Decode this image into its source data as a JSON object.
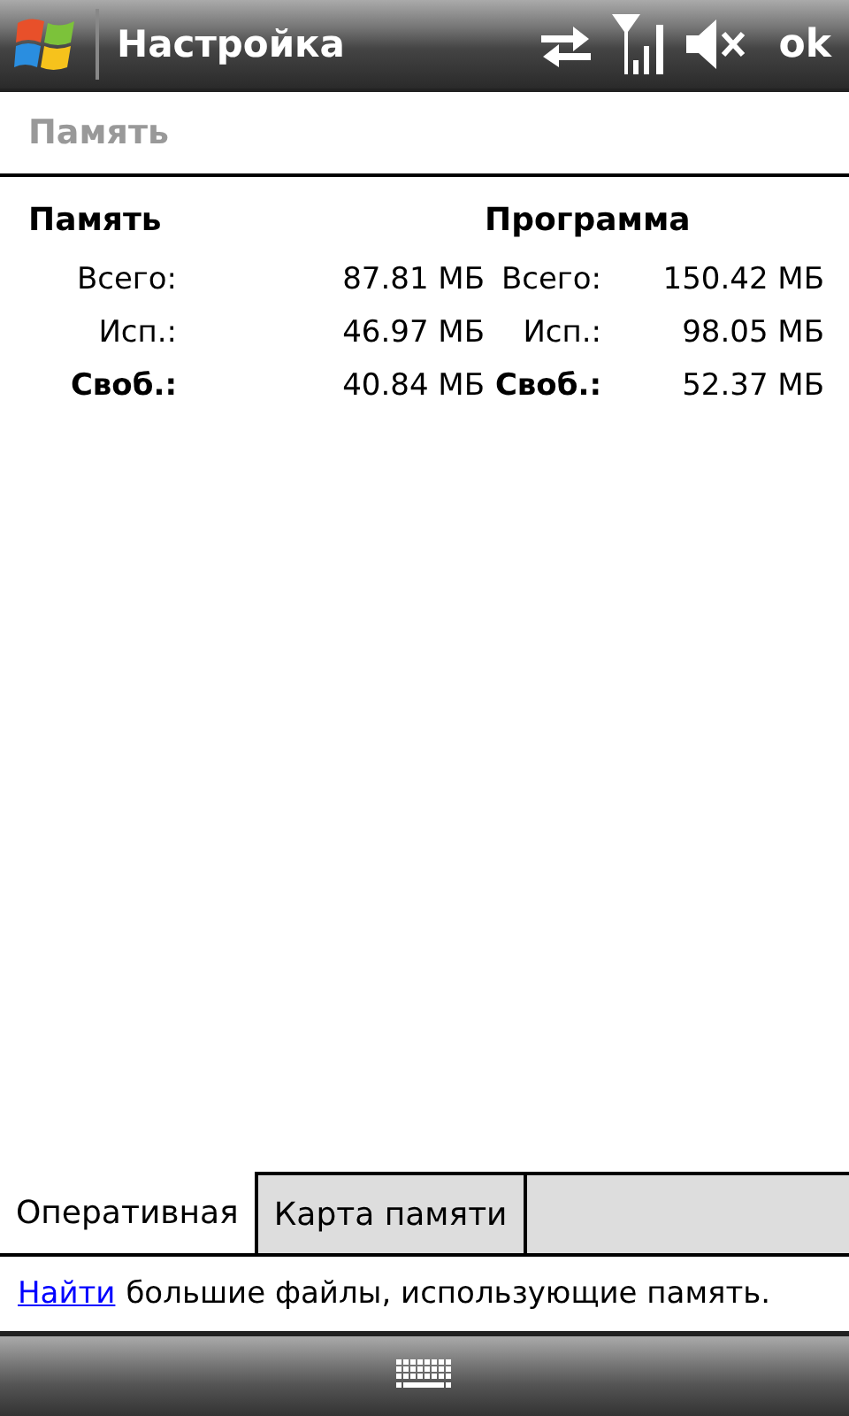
{
  "title_bar": {
    "title": "Настройка",
    "ok": "ok"
  },
  "page_title": "Память",
  "sections": [
    {
      "heading": "Память",
      "rows": [
        {
          "label": "Всего:",
          "value": "87.81 МБ",
          "bold": false
        },
        {
          "label": "Исп.:",
          "value": "46.97 МБ",
          "bold": false
        },
        {
          "label": "Своб.:",
          "value": "40.84 МБ",
          "bold": true
        }
      ]
    },
    {
      "heading": "Программа",
      "rows": [
        {
          "label": "Всего:",
          "value": "150.42 МБ",
          "bold": false
        },
        {
          "label": "Исп.:",
          "value": "98.05 МБ",
          "bold": false
        },
        {
          "label": "Своб.:",
          "value": "52.37 МБ",
          "bold": true
        }
      ]
    }
  ],
  "tabs": [
    {
      "label": "Оперативная",
      "selected": true
    },
    {
      "label": "Карта памяти",
      "selected": false
    }
  ],
  "footer": {
    "link": "Найти",
    "text": "большие файлы, использующие память."
  }
}
